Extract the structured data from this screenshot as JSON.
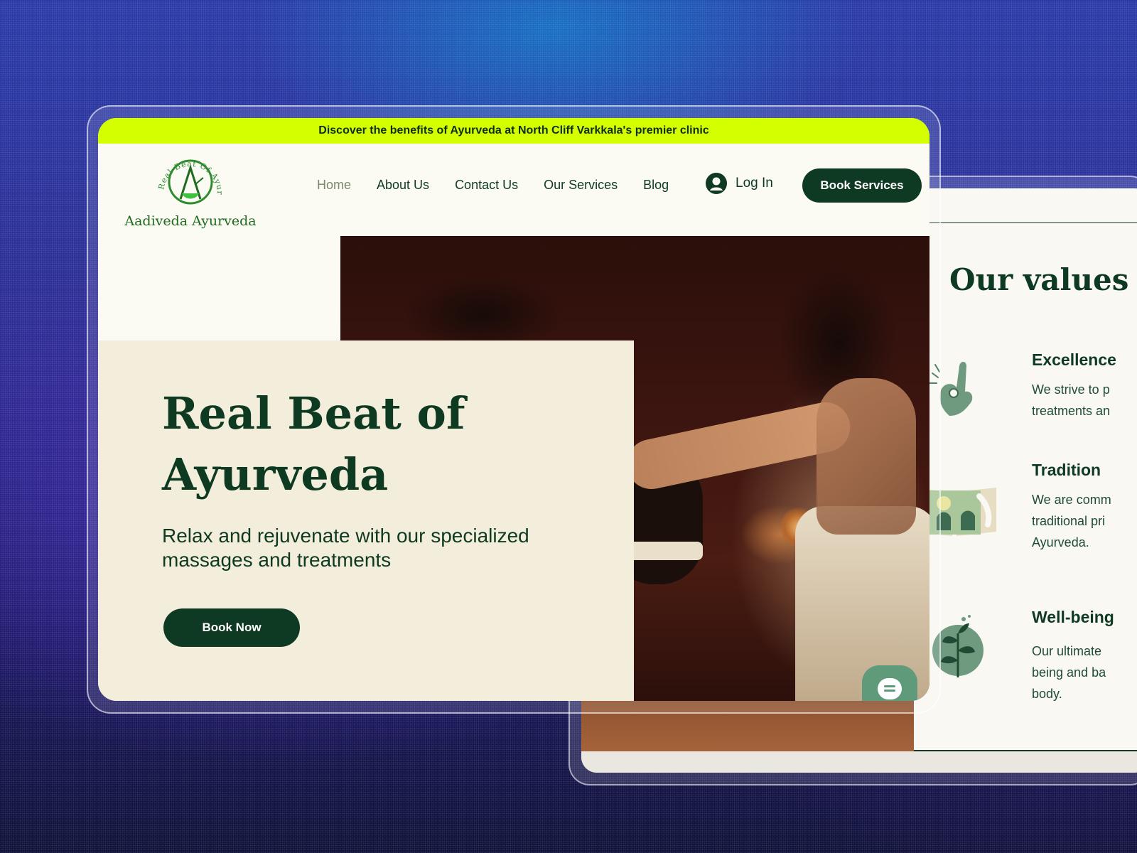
{
  "banner": {
    "text": "Discover the benefits of Ayurveda at North Cliff Varkkala's premier clinic"
  },
  "logo": {
    "arc_text": "Real Beat Of Ayurveda",
    "name": "Aadiveda Ayurveda"
  },
  "nav": {
    "items": [
      {
        "label": "Home",
        "active": true
      },
      {
        "label": "About Us",
        "active": false
      },
      {
        "label": "Contact Us",
        "active": false
      },
      {
        "label": "Our Services",
        "active": false
      },
      {
        "label": "Blog",
        "active": false
      }
    ]
  },
  "header": {
    "login_label": "Log In",
    "book_services_label": "Book Services"
  },
  "hero": {
    "title": "Real Beat of Ayurveda",
    "subtitle": "Relax and rejuvenate with our specialized massages and treatments",
    "cta_label": "Book Now"
  },
  "values": {
    "title": "Our values",
    "items": [
      {
        "title": "Excellence",
        "text": "We strive to p\ntreatments an",
        "icon": "ok-hand-icon"
      },
      {
        "title": "Tradition",
        "text": "We are comm\ntraditional pri\nAyurveda.",
        "icon": "book-icon"
      },
      {
        "title": "Well-being",
        "text": "Our ultimate\nbeing and ba\nbody.",
        "icon": "leaf-icon"
      }
    ]
  },
  "colors": {
    "brand_dark_green": "#0e3a24",
    "banner_lime": "#d4ff00",
    "hero_card_cream": "#f3eddc",
    "page_bg": "#fbfaf3",
    "icon_sage": "#6f9a80"
  }
}
